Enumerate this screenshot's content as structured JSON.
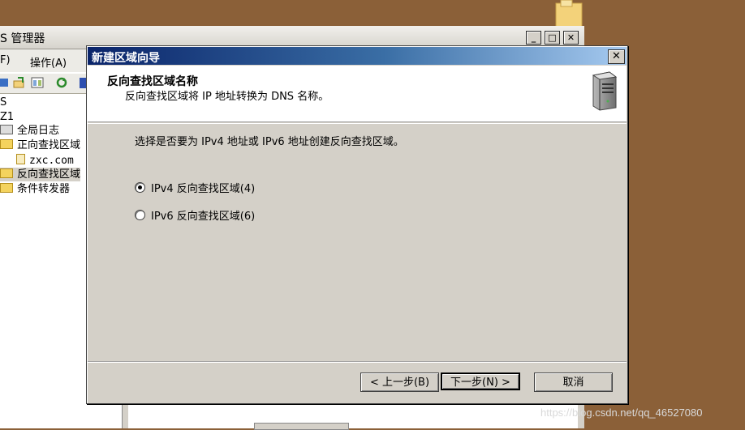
{
  "mmc": {
    "title": "S 管理器",
    "menu": [
      "F)",
      "操作(A)"
    ],
    "tree": [
      {
        "label": "S"
      },
      {
        "label": "Z1"
      },
      {
        "label": "全局日志"
      },
      {
        "label": "正向查找区域"
      },
      {
        "label": "zxc.com"
      },
      {
        "label": "反向查找区域"
      },
      {
        "label": "条件转发器"
      }
    ],
    "caption_buttons": {
      "minimize": "_",
      "maximize": "□",
      "close": "✕"
    }
  },
  "dialog": {
    "title": "新建区域向导",
    "close": "✕",
    "header_title": "反向查找区域名称",
    "header_subtitle": "反向查找区域将 IP 地址转换为 DNS 名称。",
    "prompt": "选择是否要为 IPv4 地址或 IPv6 地址创建反向查找区域。",
    "options": [
      {
        "label": "IPv4 反向查找区域(4)",
        "checked": true
      },
      {
        "label": "IPv6 反向查找区域(6)",
        "checked": false
      }
    ],
    "buttons": {
      "back": "< 上一步(B)",
      "next": "下一步(N) >",
      "cancel": "取消"
    }
  },
  "watermark": "https://blog.csdn.net/qq_46527080",
  "colors": {
    "desktop": "#8b6038",
    "dialog_face": "#d4d0c8",
    "title_start": "#0a246a",
    "title_end": "#a6caf0"
  }
}
